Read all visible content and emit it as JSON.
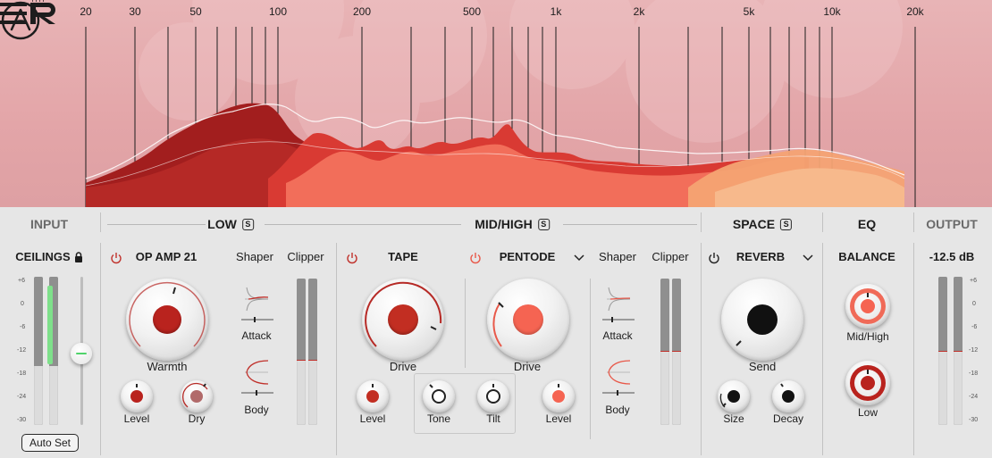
{
  "spectrum": {
    "freq_labels": [
      "20",
      "30",
      "50",
      "100",
      "200",
      "500",
      "1k",
      "2k",
      "5k",
      "10k",
      "20k"
    ]
  },
  "sections": {
    "input": "INPUT",
    "low": "LOW",
    "mid_high": "MID/HIGH",
    "space": "SPACE",
    "eq": "EQ",
    "output": "OUTPUT",
    "solo_badge": "S"
  },
  "input": {
    "ceilings": "CEILINGS",
    "auto_set": "Auto Set",
    "scale": [
      "+6",
      "0",
      "-6",
      "-12",
      "-18",
      "-24",
      "-30"
    ]
  },
  "low": {
    "module": "OP AMP 21",
    "warmth": "Warmth",
    "level": "Level",
    "dry": "Dry",
    "shaper": "Shaper",
    "clipper": "Clipper",
    "attack": "Attack",
    "body": "Body"
  },
  "mid_high": {
    "tape": "TAPE",
    "tape_drive": "Drive",
    "tape_level": "Level",
    "tone": "Tone",
    "tilt": "Tilt",
    "pentode": "PENTODE",
    "pentode_drive": "Drive",
    "pentode_level": "Level",
    "shaper": "Shaper",
    "clipper": "Clipper",
    "attack": "Attack",
    "body": "Body"
  },
  "space": {
    "module": "REVERB",
    "send": "Send",
    "size": "Size",
    "decay": "Decay"
  },
  "eq": {
    "balance": "BALANCE",
    "mid_high": "Mid/High",
    "low": "Low"
  },
  "output": {
    "value": "-12.5 dB",
    "scale": [
      "+6",
      "0",
      "-6",
      "-12",
      "-18",
      "-24",
      "-30"
    ]
  },
  "colors": {
    "accent_red": "#c0302a",
    "accent_coral": "#f05a4a",
    "meter_green": "#7ee08a"
  }
}
